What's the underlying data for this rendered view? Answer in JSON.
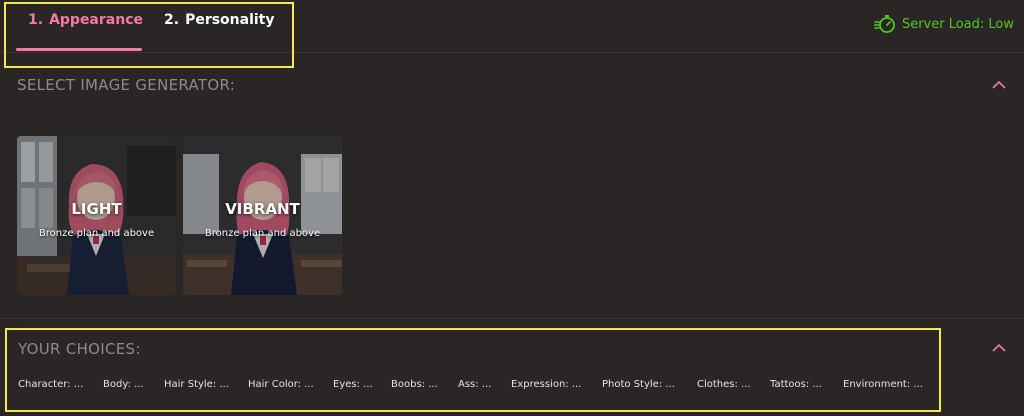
{
  "tabs": [
    {
      "number": "1.",
      "label": "Appearance",
      "active": true
    },
    {
      "number": "2.",
      "label": "Personality",
      "active": false
    }
  ],
  "server_load": {
    "label": "Server Load: Low",
    "icon": "stopwatch-icon",
    "color": "#52c81f"
  },
  "generator_section": {
    "title": "SELECT IMAGE GENERATOR:",
    "cards": [
      {
        "title": "LIGHT",
        "subtitle": "Bronze plan and above"
      },
      {
        "title": "VIBRANT",
        "subtitle": "Bronze plan and above"
      }
    ]
  },
  "choices_section": {
    "title": "YOUR CHOICES:",
    "items": [
      "Character: ...",
      "Body: ...",
      "Hair Style: ...",
      "Hair Color: ...",
      "Eyes: ...",
      "Boobs: ...",
      "Ass: ...",
      "Expression: ...",
      "Photo Style: ...",
      "Clothes: ...",
      "Tattoos: ...",
      "Environment: ..."
    ]
  },
  "colors": {
    "accent": "#f47aa6",
    "background": "#2a2625",
    "highlight": "#f5e94b",
    "muted_text": "#8e8a89"
  }
}
